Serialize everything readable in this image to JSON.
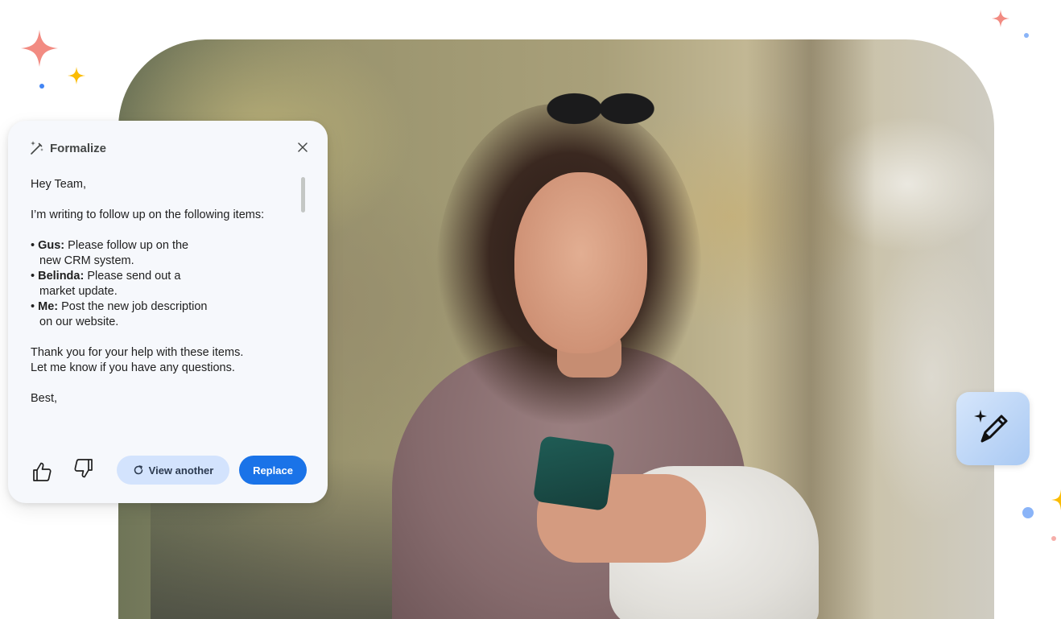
{
  "colors": {
    "accent_blue": "#1a73e8",
    "tonal_blue": "#d3e3fd",
    "card_bg": "#f6f8fc",
    "sparkle_red": "#f28b82",
    "sparkle_yellow": "#fbbc04",
    "sparkle_blue": "#4285f4"
  },
  "hero": {
    "icons": [
      "sunglasses",
      "smartphone"
    ]
  },
  "formalize_card": {
    "title": "Formalize",
    "icons": {
      "title": "magic-wand-icon",
      "close": "close-icon"
    },
    "greeting": "Hey Team,",
    "intro": "I’m writing to follow up on the following items:",
    "items": [
      {
        "lead": "Gus:",
        "text": "Please follow up on the",
        "continuation": "new CRM system."
      },
      {
        "lead": "Belinda:",
        "text": "Please send out a",
        "continuation": "market update."
      },
      {
        "lead": "Me:",
        "text": "Post the new job description",
        "continuation": "on our website."
      }
    ],
    "closing_line_1": "Thank you for your help with these items.",
    "closing_line_2": "Let me know if you have any questions.",
    "sign_off": "Best,",
    "actions": {
      "thumbs_up_icon": "thumbs-up-icon",
      "thumbs_down_icon": "thumbs-down-icon",
      "view_another_label": "View another",
      "replace_label": "Replace"
    }
  },
  "pen_button": {
    "icon": "magic-pen-icon"
  }
}
